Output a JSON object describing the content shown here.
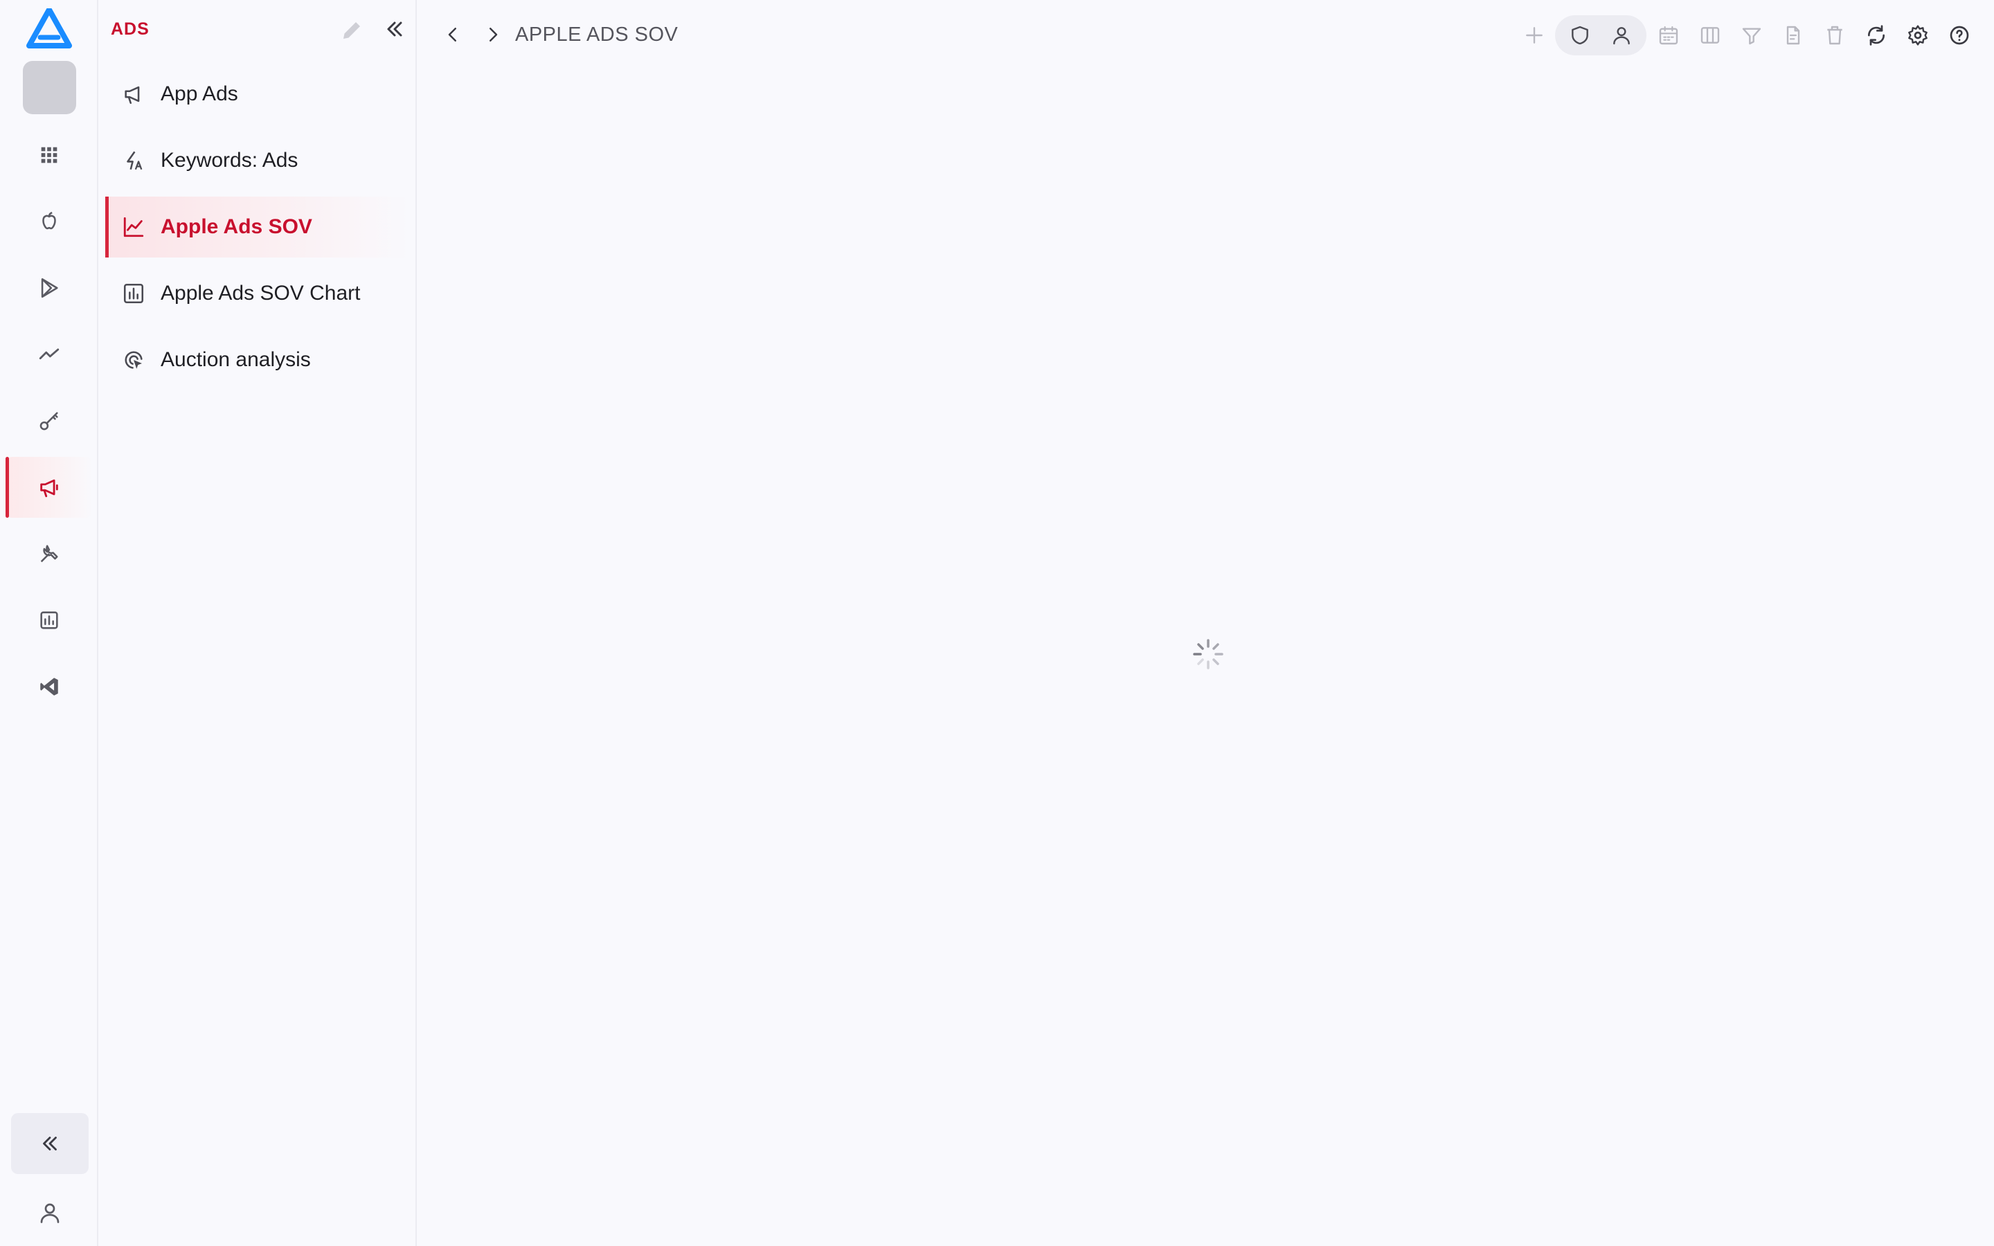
{
  "sidebar": {
    "title": "ADS",
    "items": [
      {
        "label": "App Ads",
        "icon": "megaphone-icon"
      },
      {
        "label": "Keywords: Ads",
        "icon": "keyword-ads-icon"
      },
      {
        "label": "Apple Ads SOV",
        "icon": "line-chart-icon",
        "active": true
      },
      {
        "label": "Apple Ads SOV Chart",
        "icon": "bar-chart-icon"
      },
      {
        "label": "Auction analysis",
        "icon": "auction-icon"
      }
    ]
  },
  "rail": {
    "items": [
      "grid-icon",
      "apple-icon",
      "play-store-icon",
      "trend-icon",
      "key-icon",
      "megaphone-icon",
      "tools-icon",
      "report-icon",
      "vscode-icon"
    ],
    "active": "megaphone-icon"
  },
  "header": {
    "title": "APPLE ADS SOV"
  },
  "toolbar": {
    "buttons": [
      "plus-icon",
      "shield-icon",
      "user-icon",
      "calendar-icon",
      "columns-icon",
      "filter-icon",
      "export-icon",
      "trash-icon",
      "refresh-icon",
      "settings-icon",
      "help-icon"
    ]
  },
  "colors": {
    "accent": "#c8102e",
    "background": "#f9f9fd",
    "logo": "#1a8cff"
  },
  "status": {
    "loading": true
  }
}
